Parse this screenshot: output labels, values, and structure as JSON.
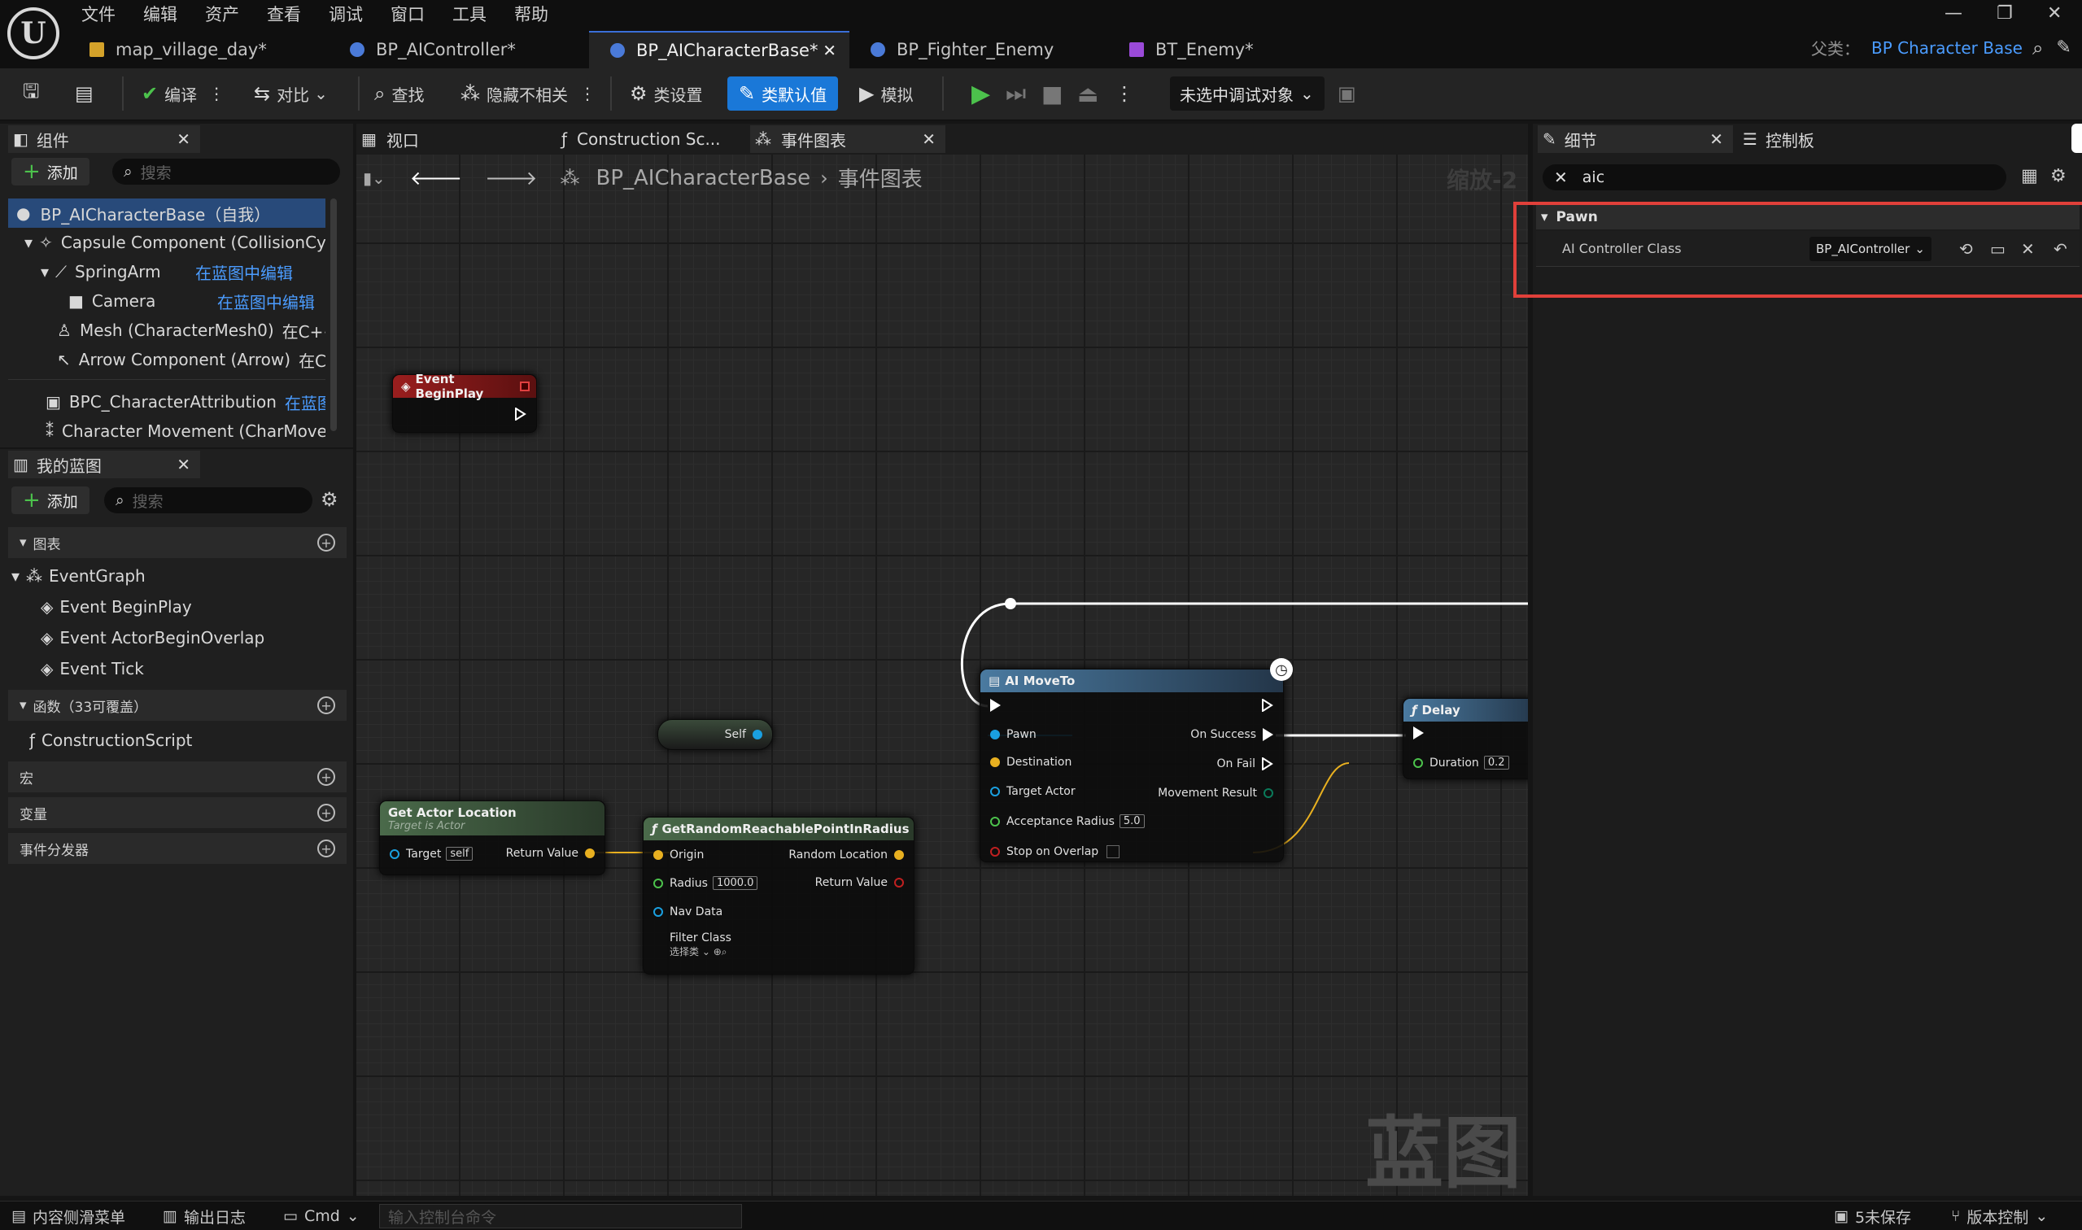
{
  "menu": [
    "文件",
    "编辑",
    "资产",
    "查看",
    "调试",
    "窗口",
    "工具",
    "帮助"
  ],
  "doc_tabs": [
    {
      "label": "map_village_day*",
      "active": false
    },
    {
      "label": "BP_AIController*",
      "active": false
    },
    {
      "label": "BP_AICharacterBase*",
      "active": true
    },
    {
      "label": "BP_Fighter_Enemy",
      "active": false
    },
    {
      "label": "BT_Enemy*",
      "active": false
    }
  ],
  "parent_class": {
    "label": "父类：",
    "value": "BP Character Base"
  },
  "toolbar": {
    "compile": "编译",
    "diff": "对比",
    "find": "查找",
    "hide_unrelated": "隐藏不相关",
    "class_settings": "类设置",
    "class_defaults": "类默认值",
    "simulate": "模拟",
    "debug_target": "未选中调试对象"
  },
  "components_panel": {
    "tab": "组件",
    "add": "添加",
    "search_placeholder": "搜索",
    "items": [
      {
        "name": "BP_AICharacterBase（自我）",
        "link": ""
      },
      {
        "name": "Capsule Component (CollisionCylin",
        "link": ""
      },
      {
        "name": "SpringArm",
        "link": "在蓝图中编辑"
      },
      {
        "name": "Camera",
        "link": "在蓝图中编辑"
      },
      {
        "name": "Mesh (CharacterMesh0)",
        "link": "在C++中"
      },
      {
        "name": "Arrow Component (Arrow)",
        "link": "在C++"
      },
      {
        "name": "BPC_CharacterAttribution",
        "link": "在蓝图中"
      },
      {
        "name": "Character Movement (CharMoveCo",
        "link": ""
      }
    ]
  },
  "my_blueprint": {
    "tab": "我的蓝图",
    "add": "添加",
    "search_placeholder": "搜索",
    "graphs_section": "图表",
    "event_graph": "EventGraph",
    "events": [
      "Event BeginPlay",
      "Event ActorBeginOverlap",
      "Event Tick"
    ],
    "functions_section": "函数（33可覆盖）",
    "construction_script": "ConstructionScript",
    "macros_section": "宏",
    "variables_section": "变量",
    "dispatchers_section": "事件分发器"
  },
  "graph_tabs": [
    {
      "label": "视口",
      "active": false
    },
    {
      "label": "Construction Sc...",
      "active": false
    },
    {
      "label": "事件图表",
      "active": true
    }
  ],
  "breadcrumb": {
    "blueprint": "BP_AICharacterBase",
    "graph": "事件图表",
    "zoom": "缩放-2"
  },
  "watermark": "蓝图",
  "nodes": {
    "begin_play": {
      "title": "Event BeginPlay"
    },
    "self": {
      "label": "Self"
    },
    "get_actor_location": {
      "title": "Get Actor Location",
      "subtitle": "Target is Actor",
      "target": "Target",
      "target_value": "self",
      "return_value": "Return Value"
    },
    "get_random": {
      "title": "GetRandomReachablePointInRadius",
      "origin": "Origin",
      "radius": "Radius",
      "radius_value": "1000.0",
      "nav_data": "Nav Data",
      "filter_class": "Filter Class",
      "filter_value": "选择类",
      "random_location": "Random Location",
      "return_value": "Return Value"
    },
    "ai_moveto": {
      "title": "AI MoveTo",
      "pawn": "Pawn",
      "destination": "Destination",
      "target_actor": "Target Actor",
      "acceptance_radius": "Acceptance Radius",
      "acceptance_value": "5.0",
      "stop_on_overlap": "Stop on Overlap",
      "on_success": "On Success",
      "on_fail": "On Fail",
      "movement_result": "Movement Result"
    },
    "delay": {
      "title": "Delay",
      "duration": "Duration",
      "duration_value": "0.2"
    }
  },
  "details_panel": {
    "tab": "细节",
    "palette_tab": "控制板",
    "search_value": "aic",
    "category": "Pawn",
    "property_label": "AI Controller Class",
    "property_value": "BP_AIController"
  },
  "statusbar": {
    "content_drawer": "内容侧滑菜单",
    "output_log": "输出日志",
    "cmd": "Cmd",
    "console_placeholder": "输入控制台命令",
    "unsaved": "5未保存",
    "source_control": "版本控制"
  },
  "colors": {
    "accent": "#1a78d8",
    "highlight_red": "#e0403a",
    "event_red": "#8a1c1c",
    "function_green": "#3c5c3c",
    "async_blue": "#3a5a7a"
  }
}
